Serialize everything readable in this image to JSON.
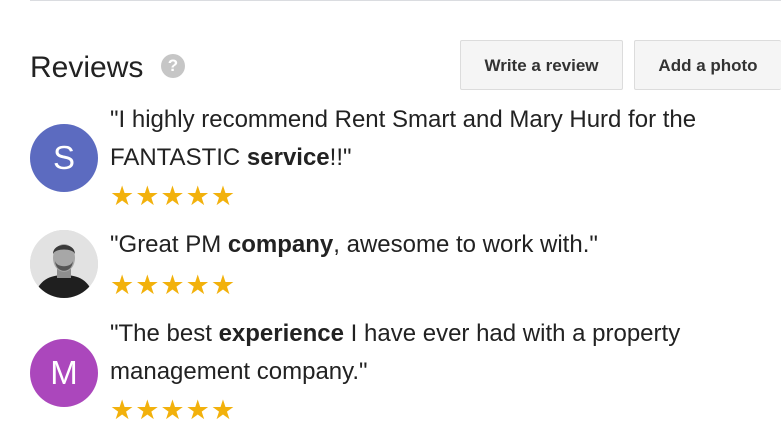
{
  "section": {
    "title": "Reviews",
    "help_icon_glyph": "?",
    "help_icon": "help-circle-icon"
  },
  "actions": {
    "write_review_label": "Write a review",
    "add_photo_label": "Add a photo"
  },
  "colors": {
    "star": "#f2b10c",
    "avatar_s": "#5c6bc0",
    "avatar_m": "#ab47bc",
    "button_bg": "#f5f5f5"
  },
  "reviews": [
    {
      "avatar_letter": "S",
      "avatar_type": "letter",
      "text_parts": [
        "\"I highly recommend Rent Smart and Mary Hurd for the FANTASTIC ",
        "service",
        "!!\""
      ],
      "rating": 5,
      "stars": "★★★★★"
    },
    {
      "avatar_letter": "",
      "avatar_type": "photo",
      "text_parts": [
        "\"Great PM ",
        "company",
        ", awesome to work with.\""
      ],
      "rating": 5,
      "stars": "★★★★★"
    },
    {
      "avatar_letter": "M",
      "avatar_type": "letter",
      "text_parts": [
        "\"The best ",
        "experience",
        " I have ever had with a property management company.\""
      ],
      "rating": 5,
      "stars": "★★★★★"
    }
  ]
}
